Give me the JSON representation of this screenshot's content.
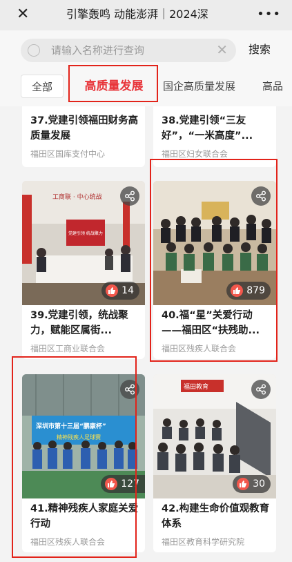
{
  "header": {
    "title": "引擎轰鸣 动能澎湃｜2024深"
  },
  "search": {
    "placeholder": "请输入名称进行查询",
    "button": "搜索"
  },
  "tabs": [
    {
      "label": "全部"
    },
    {
      "label": "高质量发展"
    },
    {
      "label": "国企高质量发展"
    },
    {
      "label": "高品"
    }
  ],
  "cards": [
    {
      "title": "37.党建引领福田财务高质量发展",
      "org": "福田区国库支付中心"
    },
    {
      "title": "38.党建引领“三友好”，“一米高度”...",
      "org": "福田区妇女联合会"
    },
    {
      "title": "39.党建引领，统战聚力，赋能区属街...",
      "org": "福田区工商业联合会",
      "likes": "14"
    },
    {
      "title": "40.福“星”关爱行动——福田区“扶残助...",
      "org": "福田区残疾人联合会",
      "likes": "879"
    },
    {
      "title": "41.精神残疾人家庭关爱行动",
      "org": "福田区残疾人联合会",
      "likes": "127"
    },
    {
      "title": "42.构建生命价值观教育体系",
      "org": "福田区教育科学研究院",
      "likes": "30"
    }
  ],
  "photo_text": {
    "c39_screen": "党建引领 统战聚力",
    "c39_wall": "工商联 · 中心统战",
    "c41_banner": "深圳市第十三届“鹏康杯”",
    "c41_sub": "精神残疾人足球赛",
    "c42_sign": "福田教育"
  },
  "colors": {
    "accent": "#e8353a",
    "like_icon": "#f2574c",
    "highlight": "#e2231a"
  }
}
